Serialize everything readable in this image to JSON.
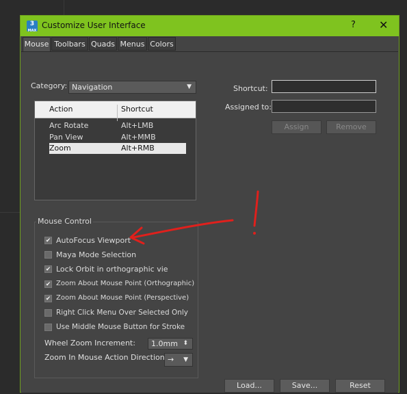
{
  "window": {
    "title": "Customize User Interface",
    "help": "?",
    "close": "✕",
    "app_icon": "3",
    "app_icon_sub": "MAX"
  },
  "tabs": [
    {
      "label": "Mouse"
    },
    {
      "label": "Toolbars"
    },
    {
      "label": "Quads"
    },
    {
      "label": "Menus"
    },
    {
      "label": "Colors"
    }
  ],
  "category": {
    "label": "Category:",
    "value": "Navigation",
    "arrow": "▼"
  },
  "action_list": {
    "headers": {
      "action": "Action",
      "shortcut": "Shortcut"
    },
    "rows": [
      {
        "action": "Arc Rotate",
        "shortcut": "Alt+LMB"
      },
      {
        "action": "Pan View",
        "shortcut": "Alt+MMB"
      },
      {
        "action": "Zoom",
        "shortcut": "Alt+RMB"
      }
    ],
    "selected_index": 2
  },
  "shortcut": {
    "label": "Shortcut:",
    "value": ""
  },
  "assigned_to": {
    "label": "Assigned to:",
    "value": ""
  },
  "buttons": {
    "assign": "Assign",
    "remove": "Remove",
    "load": "Load...",
    "save": "Save...",
    "reset": "Reset"
  },
  "mouse_control": {
    "title": "Mouse Control",
    "options": [
      {
        "label": "AutoFocus Viewport",
        "checked": true
      },
      {
        "label": "Maya Mode Selection",
        "checked": false
      },
      {
        "label": "Lock Orbit in orthographic vie",
        "checked": true
      },
      {
        "label": "Zoom About Mouse Point (Orthographic)",
        "checked": true
      },
      {
        "label": "Zoom About Mouse Point (Perspective)",
        "checked": true
      },
      {
        "label": "Right Click Menu Over Selected Only",
        "checked": false
      },
      {
        "label": "Use Middle Mouse Button for Stroke",
        "checked": false
      }
    ],
    "wheel_zoom": {
      "label": "Wheel Zoom Increment:",
      "value": "1.0mm",
      "spinner": "⬍"
    },
    "zoom_direction": {
      "label": "Zoom In Mouse Action Direction:",
      "value": "→",
      "arrow": "▼"
    }
  },
  "colors": {
    "accent": "#7fc31f",
    "annotation": "#e0201c"
  }
}
